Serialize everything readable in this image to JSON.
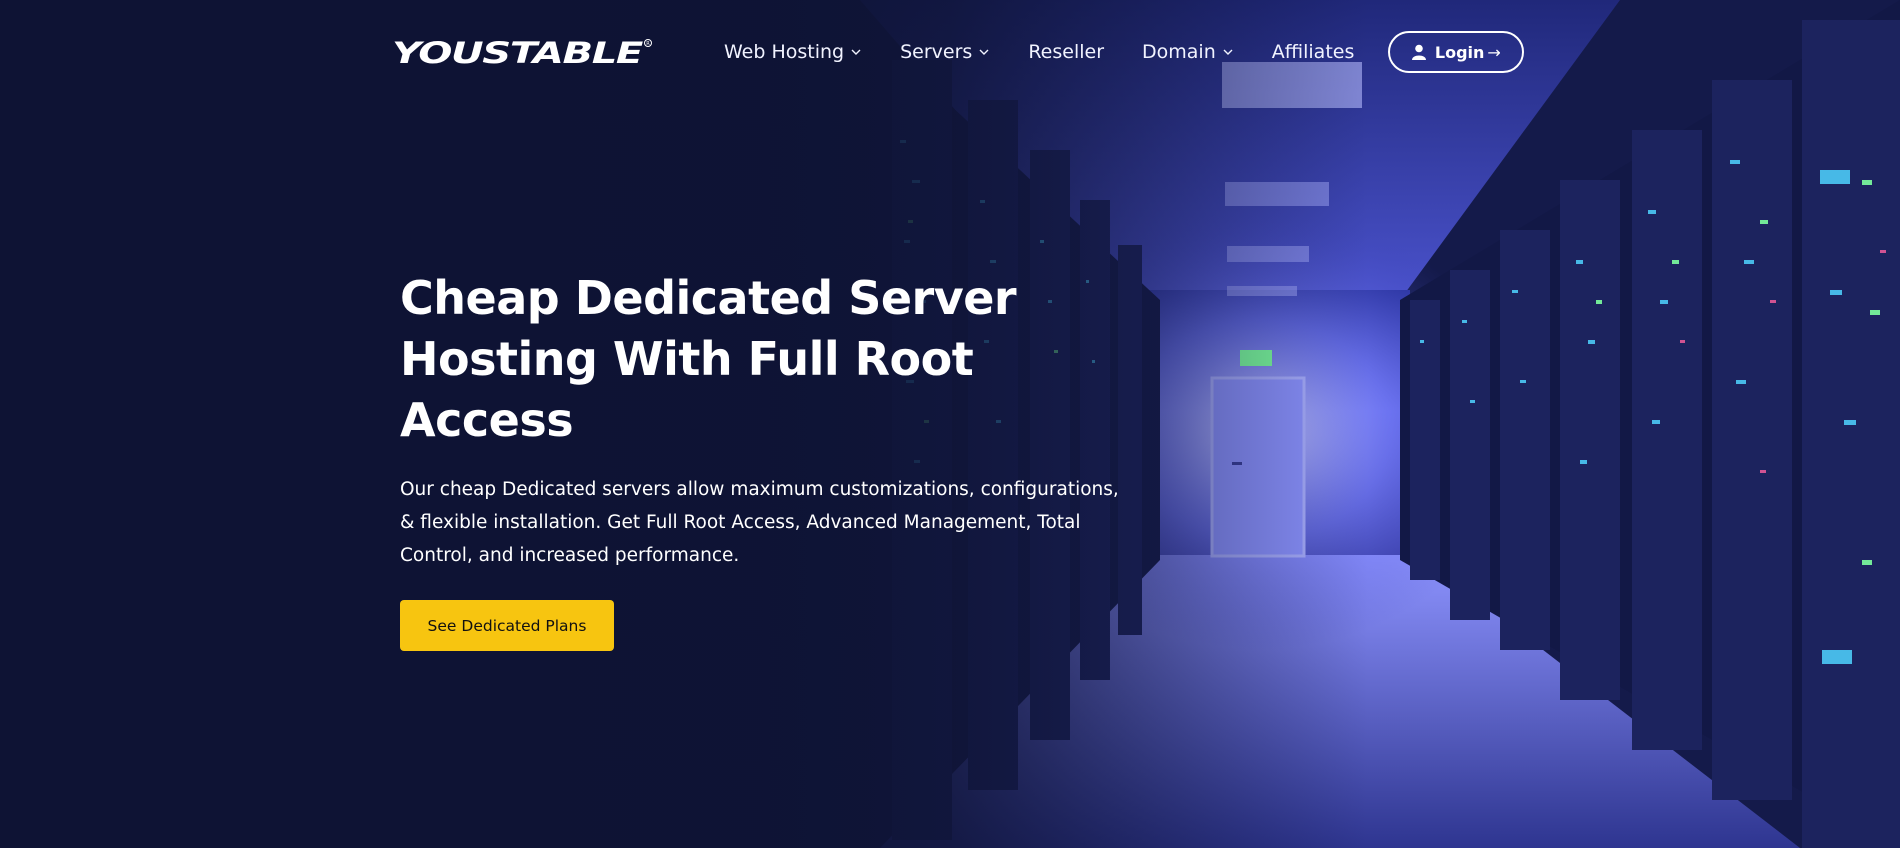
{
  "brand": {
    "logo_text": "YOUSTABLE"
  },
  "nav": {
    "items": [
      {
        "label": "Web Hosting",
        "dropdown": true
      },
      {
        "label": "Servers",
        "dropdown": true
      },
      {
        "label": "Reseller",
        "dropdown": false
      },
      {
        "label": "Domain",
        "dropdown": true
      },
      {
        "label": "Affiliates",
        "dropdown": false
      }
    ],
    "login_label": "Login",
    "login_arrow": "→"
  },
  "hero": {
    "title_line1": "Cheap Dedicated Server",
    "title_line2": "Hosting With Full Root Access",
    "description": "Our cheap Dedicated servers allow maximum customizations, configurations, & flexible installation. Get Full Root Access, Advanced Management, Total Control, and increased performance.",
    "cta_label": "See Dedicated Plans"
  },
  "colors": {
    "background": "#10163a",
    "cta": "#f7c510",
    "text": "#ffffff"
  },
  "icons": [
    "chevron-down-icon",
    "user-icon",
    "arrow-right-icon",
    "registered-mark-icon"
  ]
}
